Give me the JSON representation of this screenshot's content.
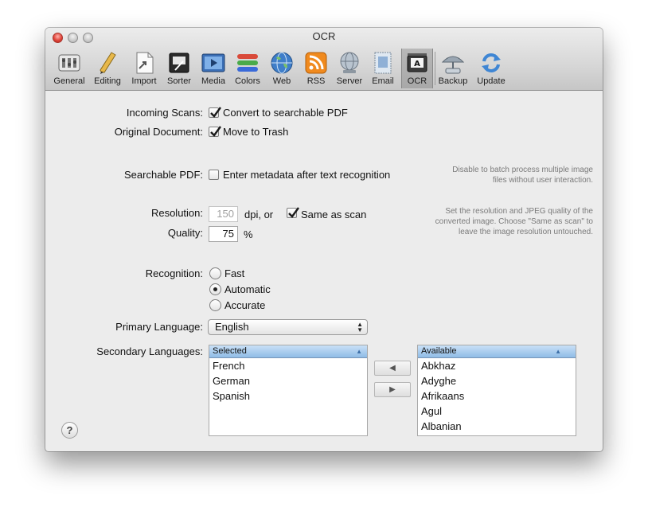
{
  "window": {
    "title": "OCR"
  },
  "toolbar": {
    "items": [
      {
        "label": "General",
        "icon": "general-icon"
      },
      {
        "label": "Editing",
        "icon": "pencil-icon"
      },
      {
        "label": "Import",
        "icon": "import-icon"
      },
      {
        "label": "Sorter",
        "icon": "sorter-icon"
      },
      {
        "label": "Media",
        "icon": "media-icon"
      },
      {
        "label": "Colors",
        "icon": "colors-icon"
      },
      {
        "label": "Web",
        "icon": "globe-icon"
      },
      {
        "label": "RSS",
        "icon": "rss-icon"
      },
      {
        "label": "Server",
        "icon": "server-icon"
      },
      {
        "label": "Email",
        "icon": "email-icon"
      },
      {
        "label": "OCR",
        "icon": "ocr-scanner-icon",
        "selected": true
      },
      {
        "label": "Backup",
        "icon": "backup-icon"
      },
      {
        "label": "Update",
        "icon": "update-icon"
      }
    ]
  },
  "settings": {
    "incoming_scans": {
      "label": "Incoming Scans:",
      "checkbox_label": "Convert to searchable PDF",
      "checked": true
    },
    "original_document": {
      "label": "Original Document:",
      "checkbox_label": "Move to Trash",
      "checked": true
    },
    "searchable_pdf": {
      "label": "Searchable PDF:",
      "checkbox_label": "Enter metadata after text recognition",
      "checked": false,
      "help_line1": "Disable to batch process multiple image",
      "help_line2": "files without user interaction."
    },
    "resolution": {
      "label": "Resolution:",
      "value": "150",
      "unit": "dpi, or",
      "same_as_scan_label": "Same as scan",
      "same_as_scan_checked": true,
      "help_line1": "Set the resolution and JPEG quality of the",
      "help_line2": "converted image. Choose \"Same as scan\" to",
      "help_line3": "leave the image resolution untouched."
    },
    "quality": {
      "label": "Quality:",
      "value": "75",
      "unit": "%"
    },
    "recognition": {
      "label": "Recognition:",
      "options": [
        {
          "label": "Fast",
          "selected": false
        },
        {
          "label": "Automatic",
          "selected": true
        },
        {
          "label": "Accurate",
          "selected": false
        }
      ]
    },
    "primary_language": {
      "label": "Primary Language:",
      "value": "English"
    },
    "secondary_languages": {
      "label": "Secondary Languages:",
      "selected_header": "Selected",
      "selected": [
        "French",
        "German",
        "Spanish"
      ],
      "available_header": "Available",
      "available": [
        "Abkhaz",
        "Adyghe",
        "Afrikaans",
        "Agul",
        "Albanian"
      ],
      "add_button": "◀",
      "remove_button": "▶"
    }
  },
  "help_button": "?",
  "colors": {
    "accent": "#8fbce6",
    "window_bg": "#ececec"
  }
}
